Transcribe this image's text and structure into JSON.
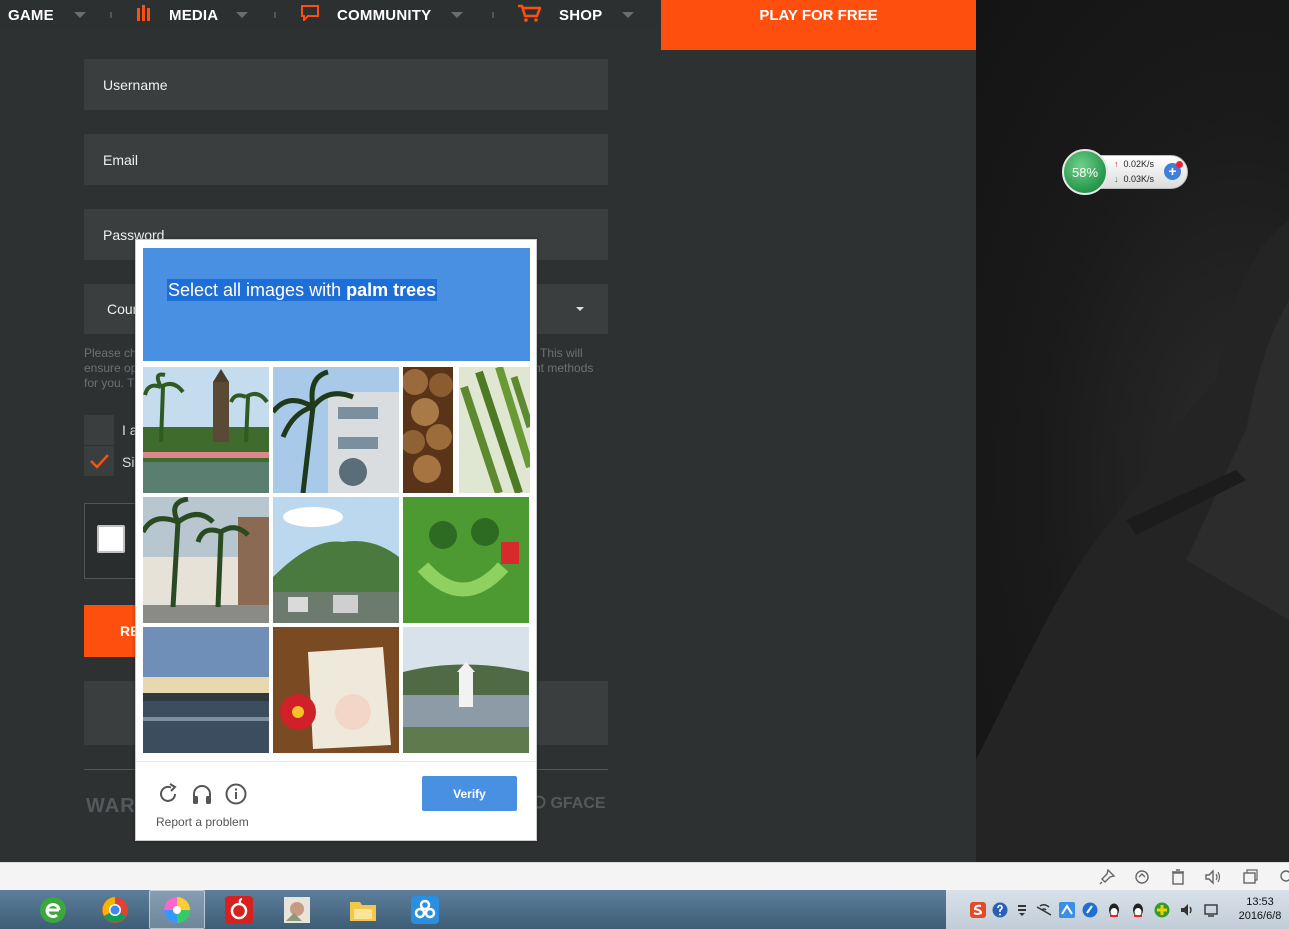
{
  "nav": {
    "items": [
      {
        "label": "GAME",
        "icon": "none"
      },
      {
        "label": "MEDIA",
        "icon": "ammo-icon"
      },
      {
        "label": "COMMUNITY",
        "icon": "chat-icon"
      },
      {
        "label": "SHOP",
        "icon": "cart-icon"
      }
    ],
    "play_button": "PLAY FOR FREE",
    "accent_color": "#ff4f0f"
  },
  "form": {
    "username_placeholder": "Username",
    "email_placeholder": "Email",
    "password_placeholder": "Password",
    "country_partial": "Cour",
    "hint_left": [
      "Please ch",
      "ensure op",
      "for you. T"
    ],
    "hint_right": [
      "This will",
      "nt methods"
    ],
    "checkbox1_partial": "I a",
    "checkbox2_partial": "Si",
    "register_partial": "RE",
    "footer_logo_left": "WAR",
    "footer_logo_right": "GFACE"
  },
  "network_widget": {
    "percent": "58%",
    "upload": "0.02K/s",
    "download": "0.03K/s"
  },
  "captcha": {
    "title_prefix": "Select all images with ",
    "title_bold": "palm trees",
    "verify": "Verify",
    "report": "Report a problem",
    "header_color": "#4a90e2",
    "tiles": [
      "palm-resort-tower",
      "palm-building-sky",
      "nuts-closeup",
      "asparagus-closeup",
      "palm-house-street",
      "green-mountain-town",
      "lawn-smiley-mower",
      "lake-sunset",
      "bag-flowers-dog",
      "lake-tower"
    ]
  },
  "tray": {
    "time": "13:53",
    "date": "2016/6/8"
  }
}
